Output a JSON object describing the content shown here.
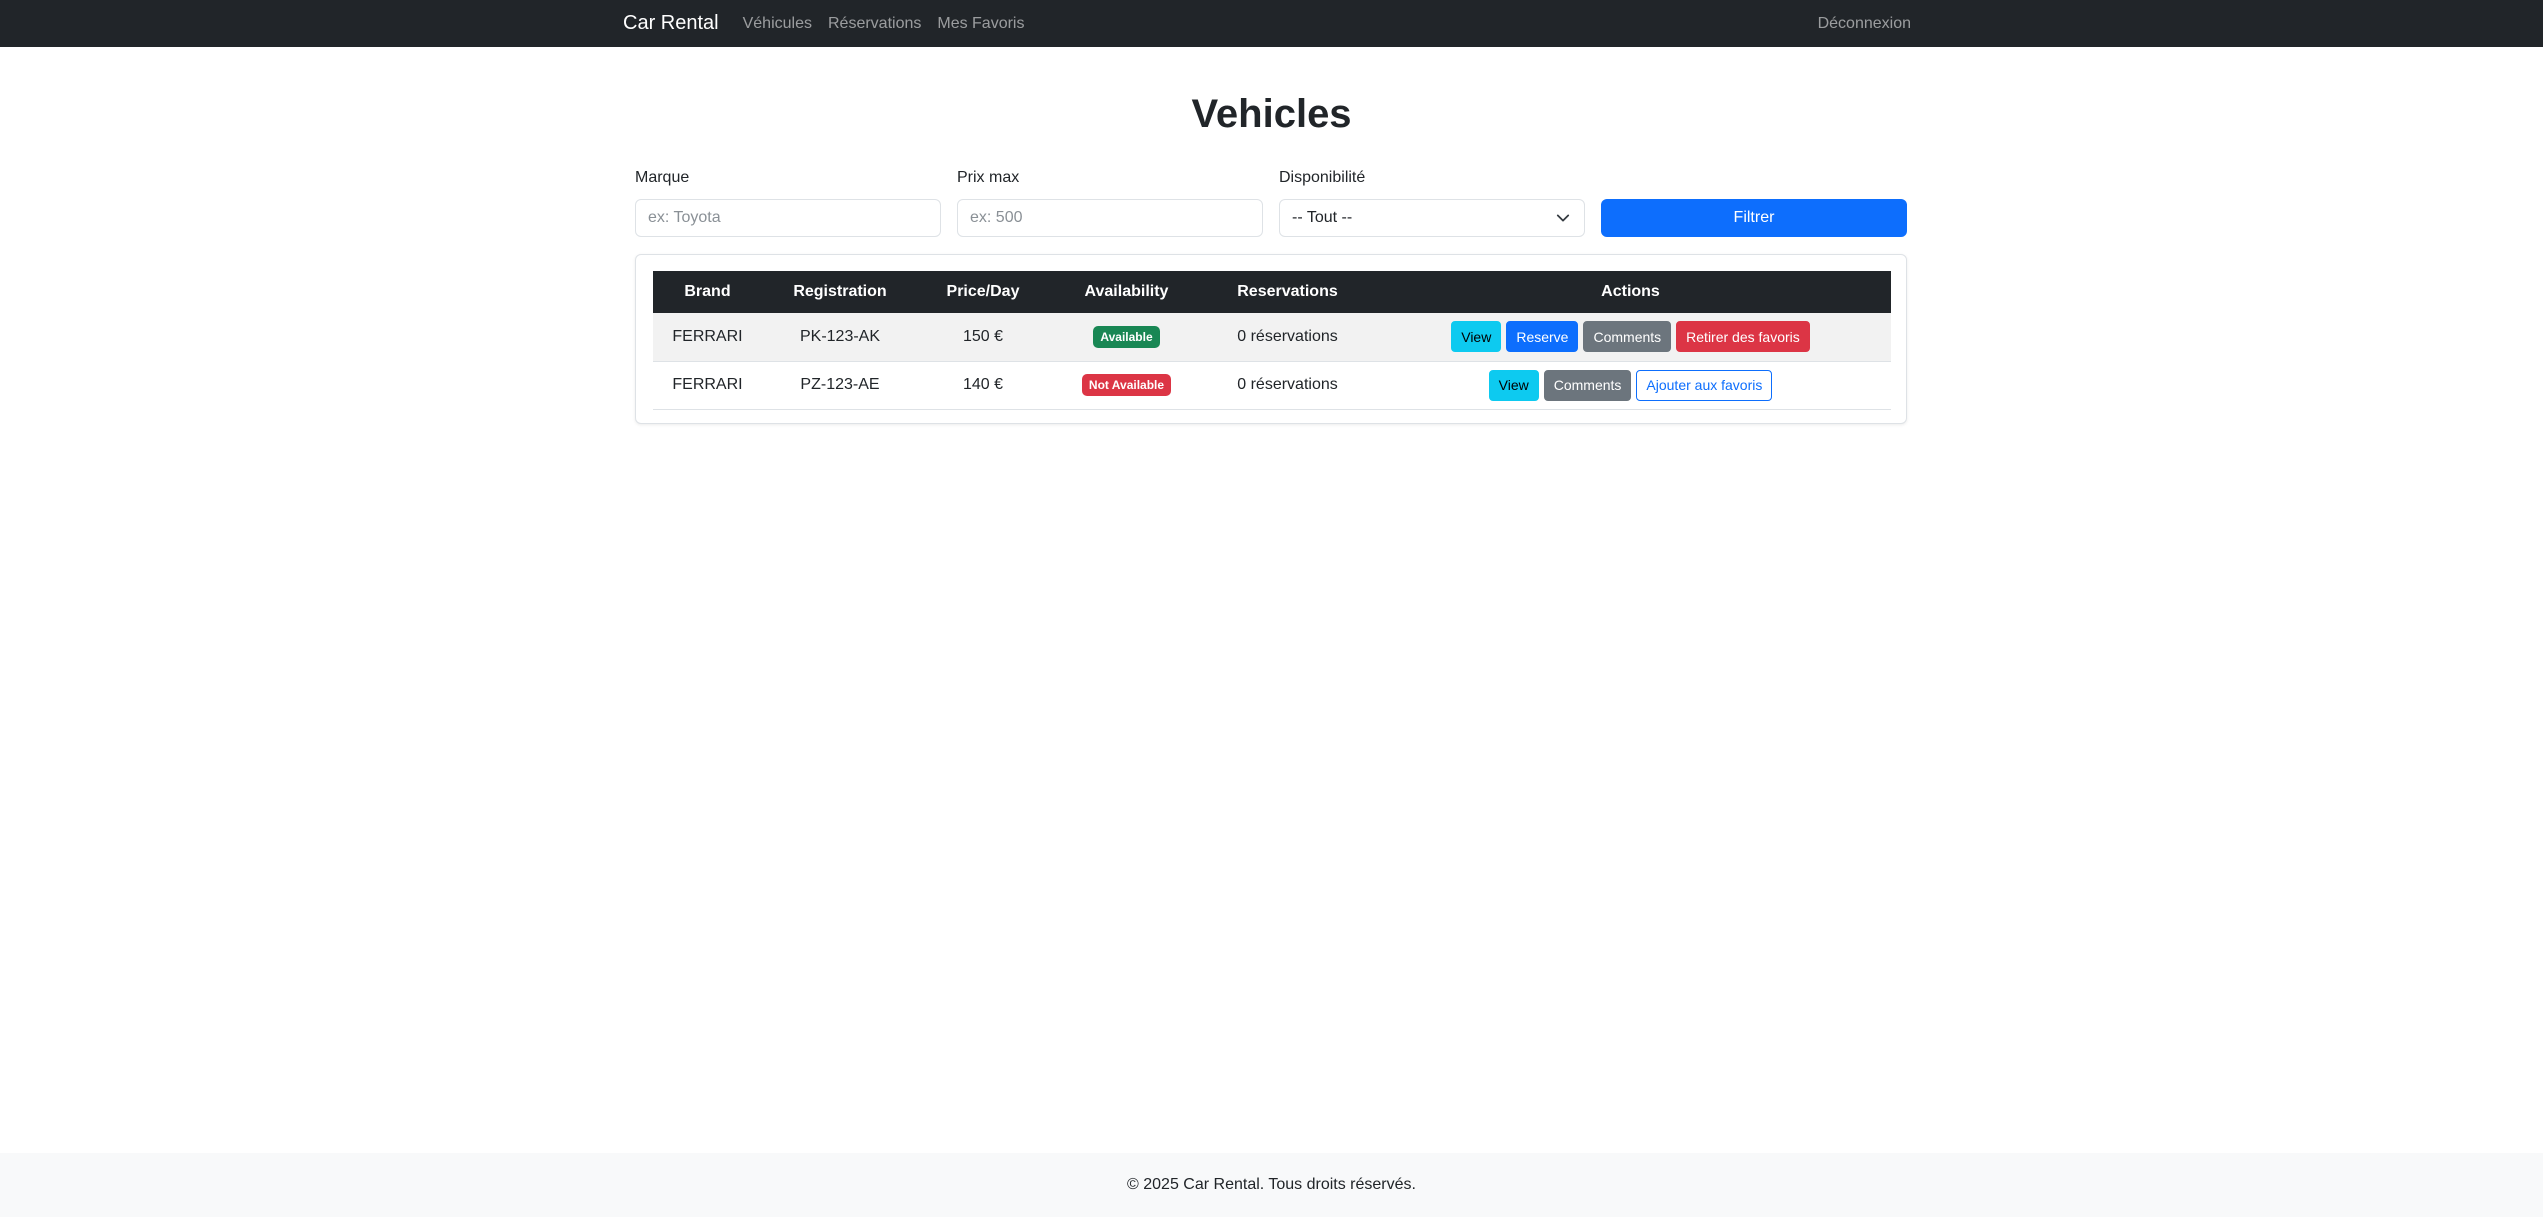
{
  "navbar": {
    "brand": "Car Rental",
    "links": [
      "Véhicules",
      "Réservations",
      "Mes Favoris"
    ],
    "logout": "Déconnexion"
  },
  "page": {
    "title": "Vehicles"
  },
  "filters": {
    "brand_label": "Marque",
    "brand_placeholder": "ex: Toyota",
    "price_label": "Prix max",
    "price_placeholder": "ex: 500",
    "availability_label": "Disponibilité",
    "availability_value": "-- Tout --",
    "submit_label": "Filtrer"
  },
  "table": {
    "headers": [
      "Brand",
      "Registration",
      "Price/Day",
      "Availability",
      "Reservations",
      "Actions"
    ],
    "rows": [
      {
        "brand": "FERRARI",
        "registration": "PK-123-AK",
        "price": "150 €",
        "availability": "Available",
        "reservations": "0 réservations",
        "actions": [
          "View",
          "Reserve",
          "Comments",
          "Retirer des favoris"
        ]
      },
      {
        "brand": "FERRARI",
        "registration": "PZ-123-AE",
        "price": "140 €",
        "availability": "Not Available",
        "reservations": "0 réservations",
        "actions": [
          "View",
          "Comments",
          "Ajouter aux favoris"
        ]
      }
    ]
  },
  "footer": {
    "text": "© 2025 Car Rental. Tous droits réservés."
  },
  "colors": {
    "navbar": "#212529",
    "primary": "#0d6efd",
    "info": "#0dcaf0",
    "secondary": "#6c757d",
    "danger": "#dc3545",
    "success": "#198754"
  }
}
